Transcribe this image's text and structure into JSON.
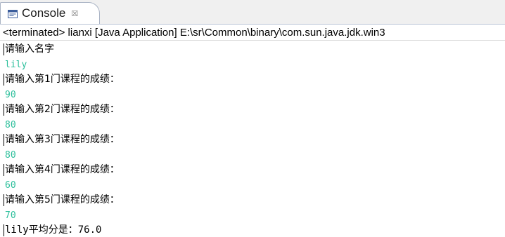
{
  "tab": {
    "label": "Console",
    "icon": "console-icon",
    "close_symbol": "☒"
  },
  "status": {
    "text": "<terminated> lianxi [Java Application] E:\\sr\\Common\\binary\\com.sun.java.jdk.win3"
  },
  "console": {
    "lines": [
      {
        "kind": "out",
        "text": "请输入名字"
      },
      {
        "kind": "in",
        "text": "lily"
      },
      {
        "kind": "out",
        "text": "请输入第1门课程的成绩："
      },
      {
        "kind": "in",
        "text": "90"
      },
      {
        "kind": "out",
        "text": "请输入第2门课程的成绩："
      },
      {
        "kind": "in",
        "text": "80"
      },
      {
        "kind": "out",
        "text": "请输入第3门课程的成绩："
      },
      {
        "kind": "in",
        "text": "80"
      },
      {
        "kind": "out",
        "text": "请输入第4门课程的成绩："
      },
      {
        "kind": "in",
        "text": "60"
      },
      {
        "kind": "out",
        "text": "请输入第5门课程的成绩："
      },
      {
        "kind": "in",
        "text": "70"
      },
      {
        "kind": "final",
        "text": "lily平均分是：76.0"
      }
    ]
  },
  "colors": {
    "input_text": "#2cbf9b",
    "output_text": "#000000",
    "tab_border": "#a9b3c4"
  }
}
